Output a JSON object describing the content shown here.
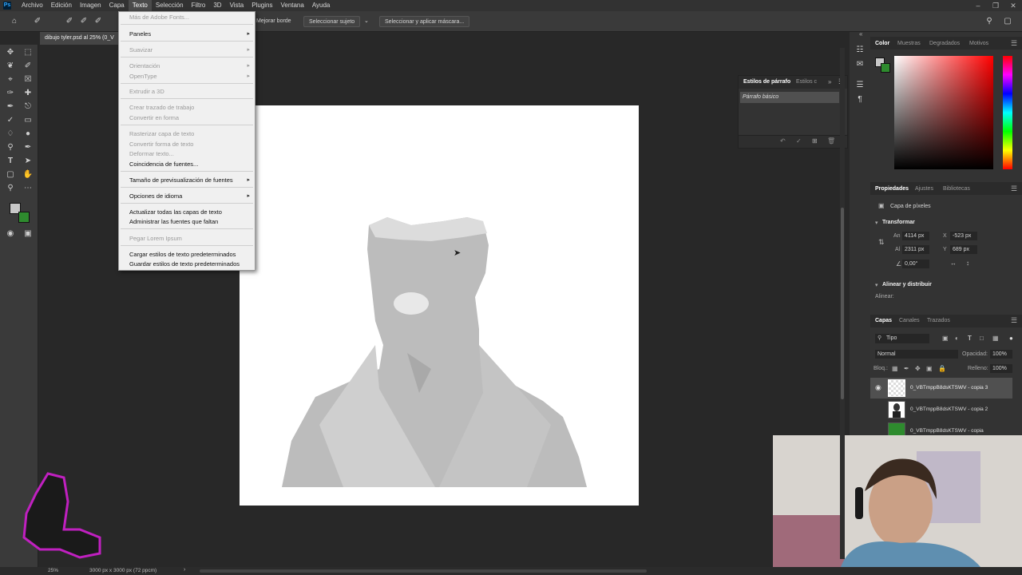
{
  "menubar": {
    "app_icon": "Ps",
    "items": [
      "Archivo",
      "Edición",
      "Imagen",
      "Capa",
      "Texto",
      "Selección",
      "Filtro",
      "3D",
      "Vista",
      "Plugins",
      "Ventana",
      "Ayuda"
    ],
    "active": "Texto"
  },
  "options_bar": {
    "refine_edge": "Mejorar borde",
    "select_subject": "Seleccionar sujeto",
    "select_mask": "Seleccionar y aplicar máscara..."
  },
  "document": {
    "tab_title": "dibujo tyler.psd al 25% (0_V"
  },
  "text_menu": {
    "items": [
      {
        "label": "Más de Adobe Fonts...",
        "disabled": true,
        "submenu": false
      },
      {
        "label": "Paneles",
        "disabled": false,
        "submenu": true
      },
      {
        "label": "Suavizar",
        "disabled": true,
        "submenu": true
      },
      {
        "label": "Orientación",
        "disabled": true,
        "submenu": true
      },
      {
        "label": "OpenType",
        "disabled": true,
        "submenu": true
      },
      {
        "label": "Extrudir a 3D",
        "disabled": true,
        "submenu": false
      },
      {
        "label": "Crear trazado de trabajo",
        "disabled": true,
        "submenu": false
      },
      {
        "label": "Convertir en forma",
        "disabled": true,
        "submenu": false
      },
      {
        "label": "Rasterizar capa de texto",
        "disabled": true,
        "submenu": false
      },
      {
        "label": "Convertir forma de texto",
        "disabled": true,
        "submenu": false
      },
      {
        "label": "Deformar texto...",
        "disabled": true,
        "submenu": false
      },
      {
        "label": "Coincidencia de fuentes...",
        "disabled": false,
        "submenu": false
      },
      {
        "label": "Tamaño de previsualización de fuentes",
        "disabled": false,
        "submenu": true
      },
      {
        "label": "Opciones de idioma",
        "disabled": false,
        "submenu": true
      },
      {
        "label": "Actualizar todas las capas de texto",
        "disabled": false,
        "submenu": false
      },
      {
        "label": "Administrar las fuentes que faltan",
        "disabled": false,
        "submenu": false
      },
      {
        "label": "Pegar Lorem Ipsum",
        "disabled": true,
        "submenu": false
      },
      {
        "label": "Cargar estilos de texto predeterminados",
        "disabled": false,
        "submenu": false
      },
      {
        "label": "Guardar estilos de texto predeterminados",
        "disabled": false,
        "submenu": false
      }
    ]
  },
  "paragraph_panel": {
    "tab_active": "Estilos de párrafo",
    "tab_other": "Estilos c",
    "style_item": "Párrafo básico"
  },
  "color_panel": {
    "tabs": [
      "Color",
      "Muestras",
      "Degradados",
      "Motivos"
    ]
  },
  "properties_panel": {
    "tabs": [
      "Propiedades",
      "Ajustes",
      "Bibliotecas"
    ],
    "layer_type": "Capa de píxeles",
    "section_transform": "Transformar",
    "w_label": "An",
    "w_value": "4114 px",
    "h_label": "Al",
    "h_value": "2311 px",
    "x_label": "X",
    "x_value": "-523 px",
    "y_label": "Y",
    "y_value": "689 px",
    "angle_value": "0,00°",
    "section_align": "Alinear y distribuir",
    "align_label": "Alinear:"
  },
  "layers_panel": {
    "tabs": [
      "Capas",
      "Canales",
      "Trazados"
    ],
    "filter_type": "Tipo",
    "blend_mode": "Normal",
    "opacity_label": "Opacidad:",
    "opacity_value": "100%",
    "lock_label": "Bloq.:",
    "fill_label": "Relleno:",
    "fill_value": "100%",
    "layers": [
      {
        "name": "0_VBTmppB8dsKTSWV - copia 3"
      },
      {
        "name": "0_VBTmppB8dsKTSWV - copia 2"
      },
      {
        "name": "0_VBTmppB8dsKTSWV - copia"
      }
    ]
  },
  "status_bar": {
    "zoom": "25%",
    "doc_size": "3000 px x 3000 px (72 ppcm)"
  }
}
